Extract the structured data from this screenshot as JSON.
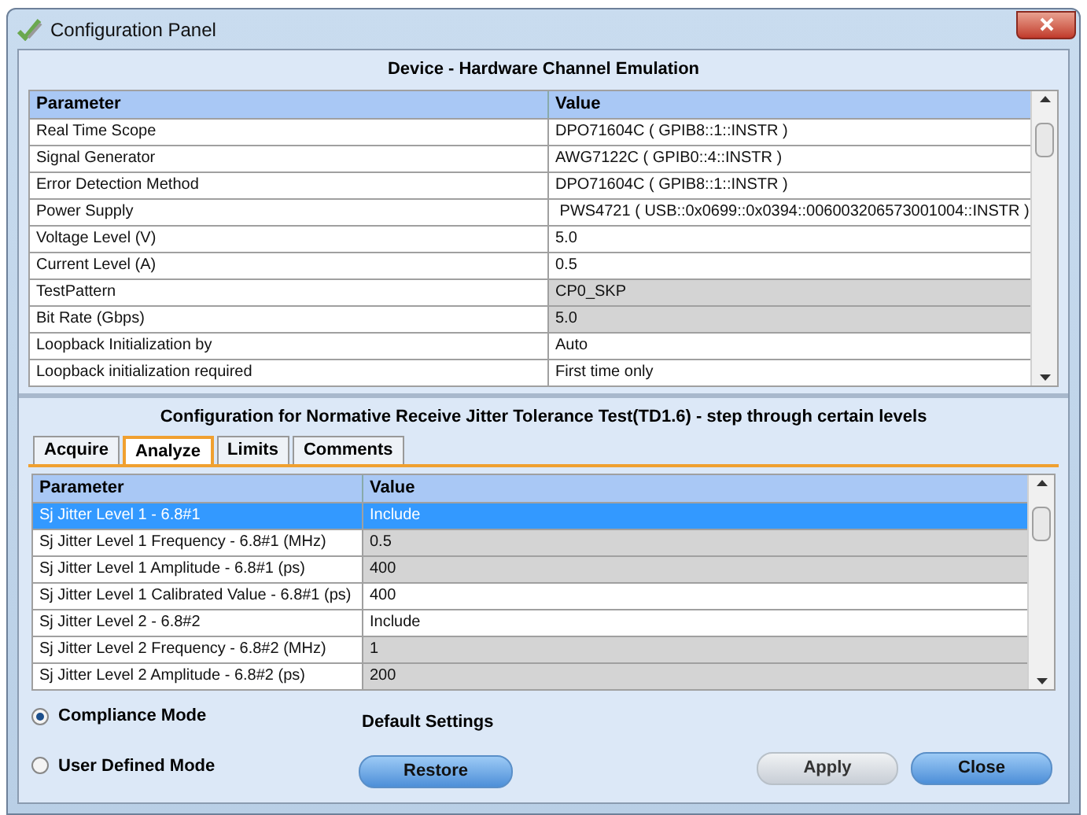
{
  "window": {
    "title": "Configuration Panel"
  },
  "device_panel": {
    "title": "Device - Hardware Channel Emulation",
    "columns": [
      "Parameter",
      "Value"
    ],
    "rows": [
      {
        "parameter": "Real Time Scope",
        "value": "DPO71604C ( GPIB8::1::INSTR )",
        "disabled": false
      },
      {
        "parameter": "Signal Generator",
        "value": "AWG7122C ( GPIB0::4::INSTR )",
        "disabled": false
      },
      {
        "parameter": "Error Detection Method",
        "value": "DPO71604C ( GPIB8::1::INSTR )",
        "disabled": false
      },
      {
        "parameter": "Power Supply",
        "value": " PWS4721 ( USB::0x0699::0x0394::006003206573001004::INSTR )",
        "disabled": false
      },
      {
        "parameter": "Voltage Level (V)",
        "value": "5.0",
        "disabled": false
      },
      {
        "parameter": "Current Level (A)",
        "value": "0.5",
        "disabled": false
      },
      {
        "parameter": "TestPattern",
        "value": "CP0_SKP",
        "disabled": true
      },
      {
        "parameter": "Bit Rate (Gbps)",
        "value": "5.0",
        "disabled": true
      },
      {
        "parameter": "Loopback Initialization by",
        "value": "Auto",
        "disabled": false
      },
      {
        "parameter": "Loopback initialization required",
        "value": "First time only",
        "disabled": false
      }
    ]
  },
  "test_panel": {
    "title": "Configuration for Normative Receive Jitter Tolerance Test(TD1.6) - step through certain levels",
    "tabs": [
      {
        "label": "Acquire",
        "selected": false
      },
      {
        "label": "Analyze",
        "selected": true
      },
      {
        "label": "Limits",
        "selected": false
      },
      {
        "label": "Comments",
        "selected": false
      }
    ],
    "columns": [
      "Parameter",
      "Value"
    ],
    "rows": [
      {
        "parameter": "Sj Jitter Level 1 - 6.8#1",
        "value": "Include",
        "disabled": false,
        "selected": true
      },
      {
        "parameter": "Sj Jitter Level 1 Frequency - 6.8#1 (MHz)",
        "value": "0.5",
        "disabled": true,
        "selected": false
      },
      {
        "parameter": "Sj Jitter Level 1 Amplitude - 6.8#1 (ps)",
        "value": "400",
        "disabled": true,
        "selected": false
      },
      {
        "parameter": "Sj Jitter Level 1 Calibrated Value - 6.8#1 (ps)",
        "value": "400",
        "disabled": false,
        "selected": false
      },
      {
        "parameter": "Sj Jitter Level 2 - 6.8#2",
        "value": "Include",
        "disabled": false,
        "selected": false
      },
      {
        "parameter": "Sj Jitter Level 2 Frequency - 6.8#2 (MHz)",
        "value": "1",
        "disabled": true,
        "selected": false
      },
      {
        "parameter": "Sj Jitter Level 2 Amplitude - 6.8#2 (ps)",
        "value": "200",
        "disabled": true,
        "selected": false
      }
    ]
  },
  "modes": [
    {
      "label": "Compliance Mode",
      "selected": true
    },
    {
      "label": "User Defined Mode",
      "selected": false
    }
  ],
  "default_settings": {
    "label": "Default Settings",
    "button": "Restore"
  },
  "buttons": [
    {
      "label": "Apply",
      "disabled": true
    },
    {
      "label": "Close",
      "disabled": false
    }
  ]
}
